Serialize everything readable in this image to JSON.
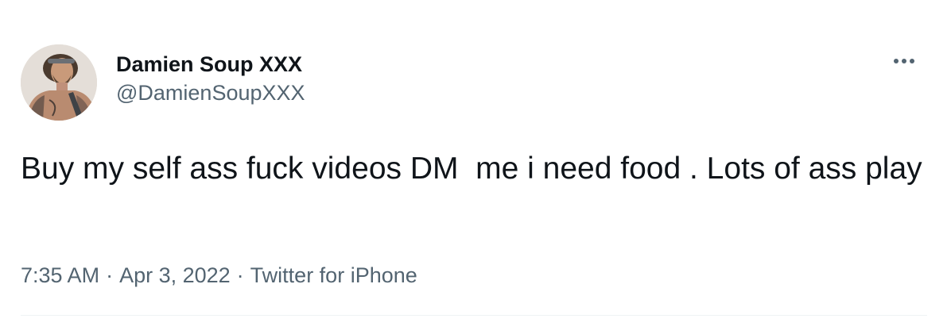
{
  "user": {
    "display_name": "Damien Soup XXX",
    "handle": "@DamienSoupXXX",
    "avatar_icon": "profile-photo"
  },
  "menu": {
    "more_icon": "more-horizontal-icon"
  },
  "tweet": {
    "text": "Buy my self ass fuck videos DM  me i need food . Lots of ass play",
    "time": "7:35 AM",
    "separator": "·",
    "date": "Apr 3, 2022",
    "source": "Twitter for iPhone"
  },
  "colors": {
    "primary_text": "#0f1419",
    "secondary_text": "#536471",
    "divider": "#eff3f4"
  }
}
